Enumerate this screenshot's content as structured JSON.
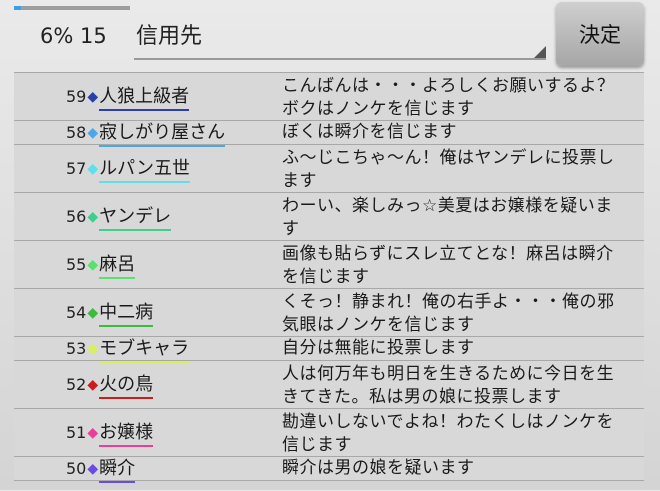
{
  "header": {
    "progress_percent": 6,
    "status_text": "6% 15",
    "target_label": "信用先",
    "decide_label": "決定"
  },
  "messages": [
    {
      "num": "59",
      "name": "人狼上級者",
      "color": "#2a3fa8",
      "text": "こんばんは・・・よろしくお願いするよ？\nボクはノンケを信じます"
    },
    {
      "num": "58",
      "name": "寂しがり屋さん",
      "color": "#4aa8e8",
      "text": "ぼくは瞬介を信じます"
    },
    {
      "num": "57",
      "name": "ルパン五世",
      "color": "#5ee0e8",
      "text": "ふ～じこちゃ～ん！俺はヤンデレに投票し\nます"
    },
    {
      "num": "56",
      "name": "ヤンデレ",
      "color": "#3ed08a",
      "text": "わーい、楽しみっ☆美夏はお嬢様を疑いま\nす"
    },
    {
      "num": "55",
      "name": "麻呂",
      "color": "#58e070",
      "text": "画像も貼らずにスレ立てとな！麻呂は瞬介\nを信じます"
    },
    {
      "num": "54",
      "name": "中二病",
      "color": "#3cbc3c",
      "text": "くそっ！静まれ！俺の右手よ・・・俺の邪\n気眼はノンケを信じます"
    },
    {
      "num": "53",
      "name": "モブキャラ",
      "color": "#d8f060",
      "text": "自分は無能に投票します"
    },
    {
      "num": "52",
      "name": "火の鳥",
      "color": "#c81e1e",
      "text": "人は何万年も明日を生きるために今日を生\nきてきた。私は男の娘に投票します"
    },
    {
      "num": "51",
      "name": "お嬢様",
      "color": "#e8409a",
      "text": "勘違いしないでよね！わたくしはノンケを\n信じます"
    },
    {
      "num": "50",
      "name": "瞬介",
      "color": "#6a4ae0",
      "text": "瞬介は男の娘を疑います"
    }
  ]
}
